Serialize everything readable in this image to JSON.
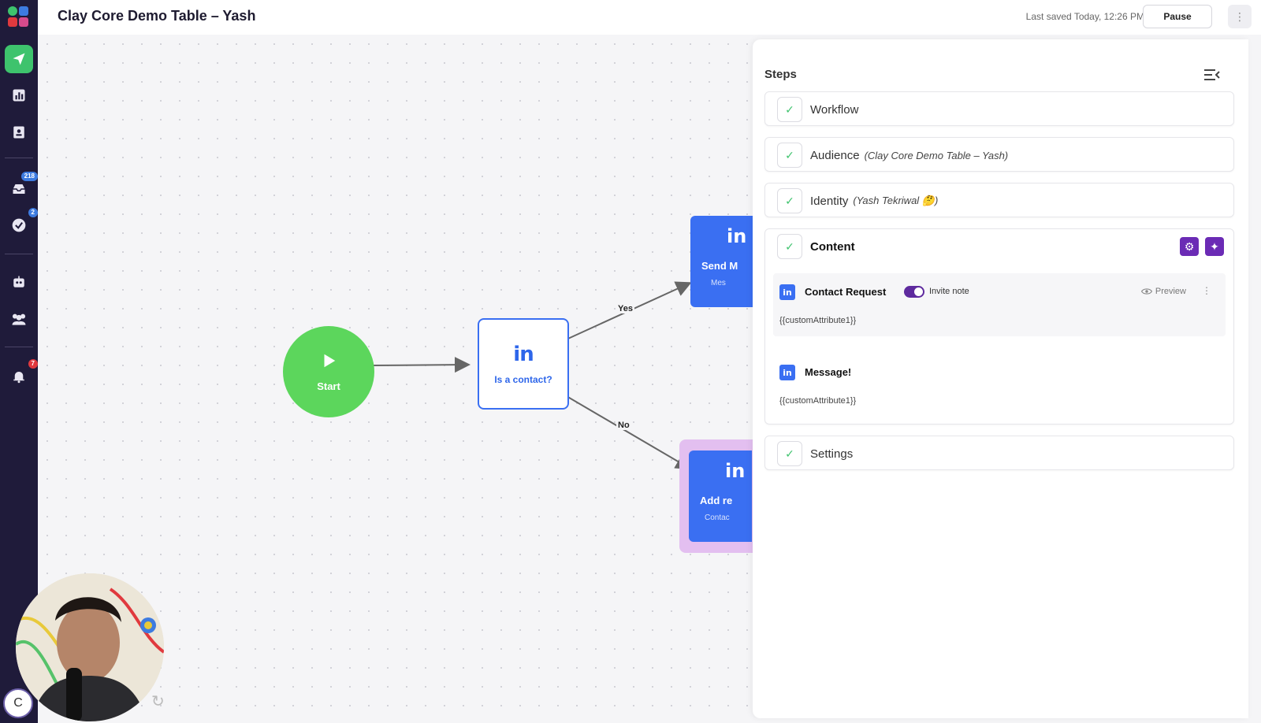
{
  "header": {
    "title": "Clay Core Demo Table – Yash",
    "last_saved": "Last saved Today, 12:26 PM",
    "pause_label": "Pause",
    "more_label": "⋮"
  },
  "sidebar": {
    "inbox_badge": "218",
    "tasks_badge": "2",
    "notifications_badge": "7",
    "avatar_letter": "C"
  },
  "canvas": {
    "start_label": "Start",
    "contact_node": {
      "icon": "in",
      "label": "Is a contact?"
    },
    "send_node": {
      "icon": "in",
      "label": "Send M",
      "sub": "Mes"
    },
    "add_node": {
      "icon": "in",
      "label": "Add re",
      "sub": "Contac"
    },
    "edge_yes": "Yes",
    "edge_no": "No"
  },
  "steps": {
    "title": "Steps",
    "items": [
      {
        "name": "Workflow",
        "detail": ""
      },
      {
        "name": "Audience",
        "detail": "(Clay Core Demo Table – Yash)"
      },
      {
        "name": "Identity",
        "detail": "(Yash Tekriwal 🤔)"
      },
      {
        "name": "Content",
        "detail": ""
      },
      {
        "name": "Settings",
        "detail": ""
      }
    ],
    "content": {
      "contact_request": {
        "title": "Contact Request",
        "toggle_label": "Invite note",
        "preview_label": "Preview",
        "text": "{{customAttribute1}}"
      },
      "message": {
        "title": "Message!",
        "text": "{{customAttribute1}}"
      }
    }
  },
  "colors": {
    "brand_green": "#3ec36d",
    "linkedin_blue": "#3a6ff2",
    "purple": "#6b2bb5",
    "sidebar_bg": "#1f1b3a"
  }
}
